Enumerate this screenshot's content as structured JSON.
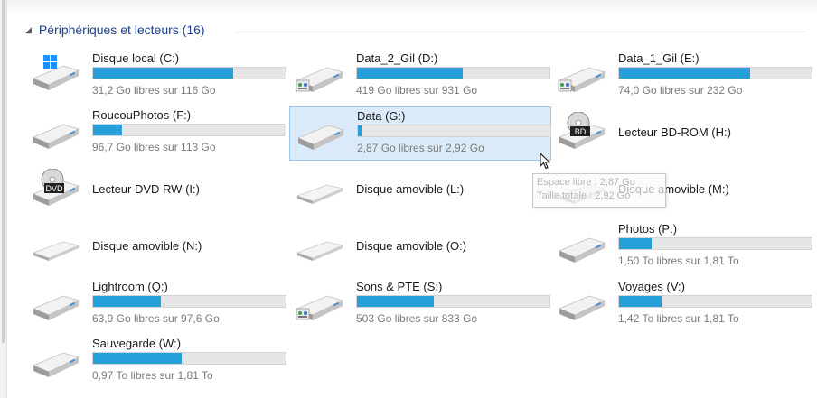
{
  "group": {
    "title": "Périphériques et lecteurs (16)"
  },
  "colors": {
    "accent": "#26a0da",
    "selection": "#dbeaf9",
    "header": "#1e3f8c"
  },
  "drives": [
    {
      "name": "Disque local (C:)",
      "free": "31,2 Go libres sur 116 Go",
      "used_fraction": 0.73,
      "icon": "windows-drive-icon"
    },
    {
      "name": "Data_2_Gil (D:)",
      "free": "419 Go libres sur 931 Go",
      "used_fraction": 0.55,
      "icon": "shared-drive-icon"
    },
    {
      "name": "Data_1_Gil (E:)",
      "free": "74,0 Go libres sur 232 Go",
      "used_fraction": 0.68,
      "icon": "shared-drive-icon"
    },
    {
      "name": "RoucouPhotos (F:)",
      "free": "96,7 Go libres sur 113 Go",
      "used_fraction": 0.15,
      "icon": "drive-icon"
    },
    {
      "name": "Data (G:)",
      "free": "2,87 Go libres sur 2,92 Go",
      "used_fraction": 0.02,
      "icon": "drive-icon"
    },
    {
      "name": "Lecteur BD-ROM (H:)",
      "icon": "bd-rom-icon",
      "badge": "BD"
    },
    {
      "name": "Lecteur DVD RW (I:)",
      "icon": "dvd-rw-icon",
      "badge": "DVD"
    },
    {
      "name": "Disque amovible (L:)",
      "icon": "removable-drive-icon"
    },
    {
      "name": "Disque amovible (M:)",
      "icon": "removable-drive-icon"
    },
    {
      "name": "Disque amovible (N:)",
      "icon": "removable-drive-icon"
    },
    {
      "name": "Disque amovible (O:)",
      "icon": "removable-drive-icon"
    },
    {
      "name": "Photos (P:)",
      "free": "1,50 To libres sur 1,81 To",
      "used_fraction": 0.17,
      "icon": "drive-icon"
    },
    {
      "name": "Lightroom (Q:)",
      "free": "63,9 Go libres sur 97,6 Go",
      "used_fraction": 0.35,
      "icon": "drive-icon"
    },
    {
      "name": "Sons & PTE (S:)",
      "free": "503 Go libres sur 833 Go",
      "used_fraction": 0.4,
      "icon": "shared-drive-icon"
    },
    {
      "name": "Voyages (V:)",
      "free": "1,42 To libres sur 1,81 To",
      "used_fraction": 0.22,
      "icon": "drive-icon"
    },
    {
      "name": "Sauvegarde (W:)",
      "free": "0,97 To libres sur 1,81 To",
      "used_fraction": 0.46,
      "icon": "drive-icon"
    }
  ],
  "tooltip": {
    "line1": "Espace libre : 2,87 Go",
    "line2": "Taille totale : 2,92 Go"
  }
}
